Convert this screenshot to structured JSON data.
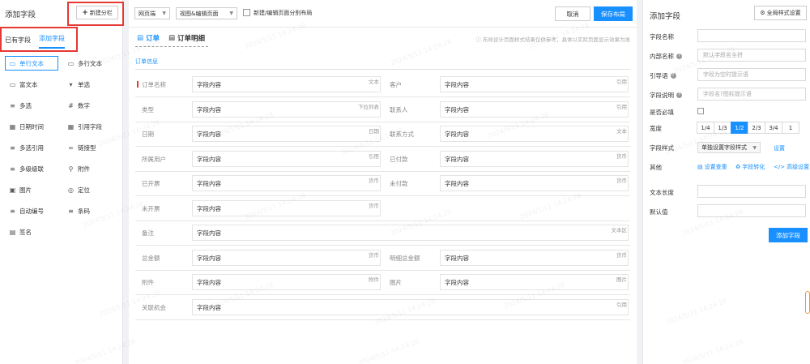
{
  "left": {
    "title": "添加字段",
    "new_button": "新建分栏",
    "tabs": [
      "已有字段",
      "添加字段"
    ],
    "fields": [
      {
        "label": "单行文本",
        "icon": "▭"
      },
      {
        "label": "多行文本",
        "icon": "▭"
      },
      {
        "label": "富文本",
        "icon": "▭"
      },
      {
        "label": "单选",
        "icon": "▾"
      },
      {
        "label": "多选",
        "icon": "≡"
      },
      {
        "label": "数字",
        "icon": "#"
      },
      {
        "label": "日期时间",
        "icon": "▦"
      },
      {
        "label": "引用字段",
        "icon": "▦"
      },
      {
        "label": "多选引用",
        "icon": "≡"
      },
      {
        "label": "链接型",
        "icon": "∞"
      },
      {
        "label": "多级级联",
        "icon": "≡"
      },
      {
        "label": "附件",
        "icon": "⚲"
      },
      {
        "label": "图片",
        "icon": "▣"
      },
      {
        "label": "定位",
        "icon": "◎"
      },
      {
        "label": "自动编号",
        "icon": "≡"
      },
      {
        "label": "条码",
        "icon": "≡"
      },
      {
        "label": "签名",
        "icon": "▤"
      }
    ]
  },
  "toolbar": {
    "page_type": "网页端",
    "view_mode": "视图&编辑页面",
    "split_layout_label": "新建/编辑页面分别布局",
    "cancel": "取消",
    "save": "保存布局"
  },
  "form": {
    "tabs": [
      "订单",
      "订单明细"
    ],
    "hint": "布局设计页面样式结果仅供参考，具体以实际页面显示效果为准",
    "section": "订单信息",
    "placeholder": "字段内容",
    "rows": [
      [
        {
          "label": "订单名称",
          "type": "文本",
          "required": true
        },
        {
          "label": "客户",
          "type": "引用"
        }
      ],
      [
        {
          "label": "类型",
          "type": "下拉列表"
        },
        {
          "label": "联系人",
          "type": "引用"
        }
      ],
      [
        {
          "label": "日期",
          "type": "日期"
        },
        {
          "label": "联系方式",
          "type": "文本"
        }
      ],
      [
        {
          "label": "所属用户",
          "type": "引用"
        },
        {
          "label": "已付款",
          "type": "货币"
        }
      ],
      [
        {
          "label": "已开票",
          "type": "货币"
        },
        {
          "label": "未付款",
          "type": "货币"
        }
      ],
      [
        {
          "label": "未开票",
          "type": "货币"
        }
      ],
      [
        {
          "label": "备注",
          "type": "文本区",
          "full": true
        }
      ],
      [
        {
          "label": "总金额",
          "type": "货币"
        },
        {
          "label": "明细总金额",
          "type": "货币"
        }
      ],
      [
        {
          "label": "附件",
          "type": "附件"
        },
        {
          "label": "图片",
          "type": "图片"
        }
      ],
      [
        {
          "label": "关联机会",
          "type": "引用",
          "full": true
        }
      ]
    ]
  },
  "right": {
    "title": "添加字段",
    "global_style_button": "全局样式设置",
    "field_name_label": "字段名称",
    "internal_name_label": "内部名称",
    "internal_name_placeholder": "默认字段名全拼",
    "guide_label": "引导语",
    "guide_placeholder": "字段为空时提示语",
    "desc_label": "字段说明",
    "desc_placeholder": "字段名?图标提示语",
    "required_label": "是否必填",
    "width_label": "宽度",
    "width_options": [
      "1/4",
      "1/3",
      "1/2",
      "2/3",
      "3/4",
      "1"
    ],
    "width_selected": "1/2",
    "style_label": "字段样式",
    "style_value": "单独设置字段样式",
    "style_link": "设置",
    "other_label": "其他",
    "other_links": [
      "设置查重",
      "字段转化",
      "高级设置"
    ],
    "text_length_label": "文本长度",
    "default_label": "默认值",
    "add_button": "添加字段"
  },
  "watermark": "2024/5/11 14:24:28"
}
